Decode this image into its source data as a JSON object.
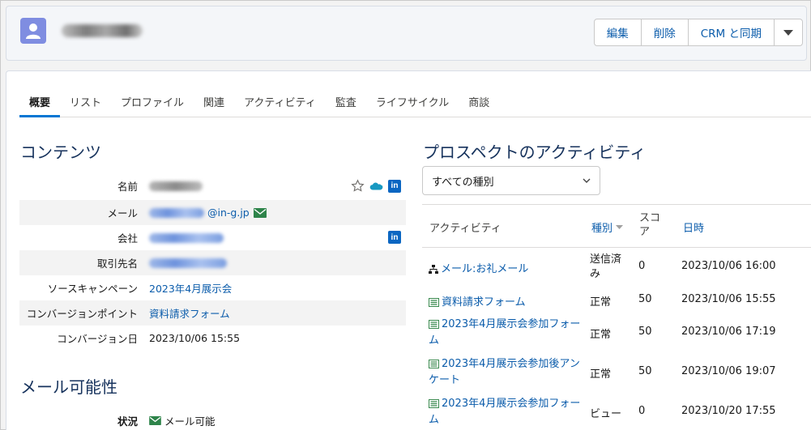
{
  "header": {
    "buttons": [
      "編集",
      "削除",
      "CRM と同期"
    ]
  },
  "tabs": [
    "概要",
    "リスト",
    "プロファイル",
    "関連",
    "アクティビティ",
    "監査",
    "ライフサイクル",
    "商談"
  ],
  "contents": {
    "title": "コンテンツ",
    "fields": [
      {
        "label": "名前",
        "value": ""
      },
      {
        "label": "メール",
        "value": "@in-g.jp"
      },
      {
        "label": "会社",
        "value": ""
      },
      {
        "label": "取引先名",
        "value": ""
      },
      {
        "label": "ソースキャンペーン",
        "value": "2023年4月展示会"
      },
      {
        "label": "コンバージョンポイント",
        "value": "資料請求フォーム"
      },
      {
        "label": "コンバージョン日",
        "value": "2023/10/06 15:55"
      }
    ]
  },
  "mail": {
    "title": "メール可能性",
    "status_label": "状況",
    "status_value": "メール可能"
  },
  "activity": {
    "title": "プロスペクトのアクティビティ",
    "filter": "すべての種別",
    "columns": {
      "activity": "アクティビティ",
      "type": "種別",
      "score_line1": "スコ",
      "score_line2": "ア",
      "date": "日時"
    },
    "rows": [
      {
        "name": "メール:お礼メール",
        "name2": "",
        "type": "送信済",
        "type2": "み",
        "score": "0",
        "date": "2023/10/06 16:00",
        "icon": "email-hierarchy-icon"
      },
      {
        "name": "資料請求フォーム",
        "name2": "",
        "type": "正常",
        "type2": "",
        "score": "50",
        "date": "2023/10/06 15:55",
        "icon": "form-icon"
      },
      {
        "name": "2023年4月展示会参加フォー",
        "name2": "ム",
        "type": "正常",
        "type2": "",
        "score": "50",
        "date": "2023/10/06 17:19",
        "icon": "form-icon"
      },
      {
        "name": "2023年4月展示会参加後アン",
        "name2": "ケート",
        "type": "正常",
        "type2": "",
        "score": "50",
        "date": "2023/10/06 19:07",
        "icon": "form-icon"
      },
      {
        "name": "2023年4月展示会参加フォー",
        "name2": "ム",
        "type": "ビュー",
        "type2": "",
        "score": "0",
        "date": "2023/10/20 17:55",
        "icon": "form-icon"
      }
    ]
  }
}
